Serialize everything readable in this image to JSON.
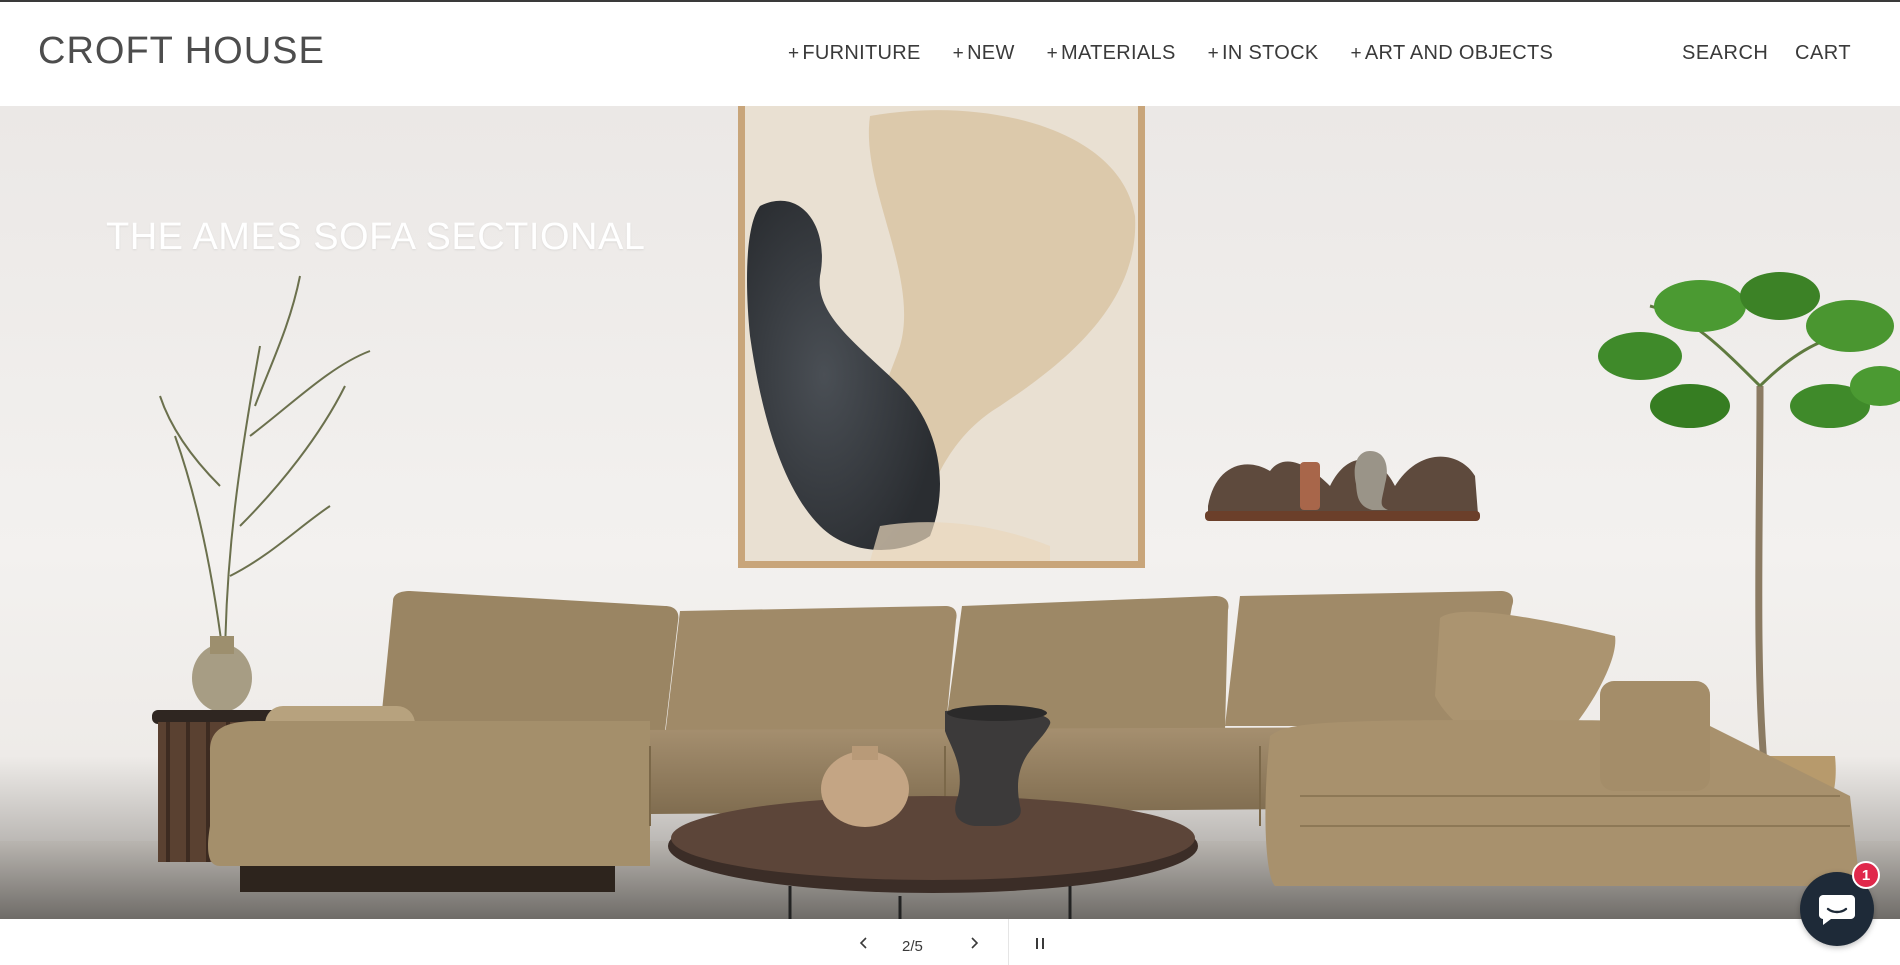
{
  "header": {
    "logo": "CROFT HOUSE",
    "nav": [
      {
        "prefix": "+",
        "label": "FURNITURE"
      },
      {
        "prefix": "+",
        "label": "NEW"
      },
      {
        "prefix": "+",
        "label": "MATERIALS"
      },
      {
        "prefix": "+",
        "label": "IN STOCK"
      },
      {
        "prefix": "+",
        "label": "ART AND OBJECTS"
      }
    ],
    "search_label": "SEARCH",
    "cart_label": "CART"
  },
  "hero": {
    "heading": "THE AMES SOFA SECTIONAL"
  },
  "slideshow": {
    "counter": "2/5",
    "prev_icon": "chevron-left-icon",
    "next_icon": "chevron-right-icon",
    "pause_icon": "pause-icon"
  },
  "chat": {
    "icon": "chat-bubble-icon",
    "badge_count": "1"
  },
  "colors": {
    "text": "#3a3a3a",
    "chat_bg": "#1e2a38",
    "badge": "#e0284b",
    "sofa": "#9c8765"
  }
}
